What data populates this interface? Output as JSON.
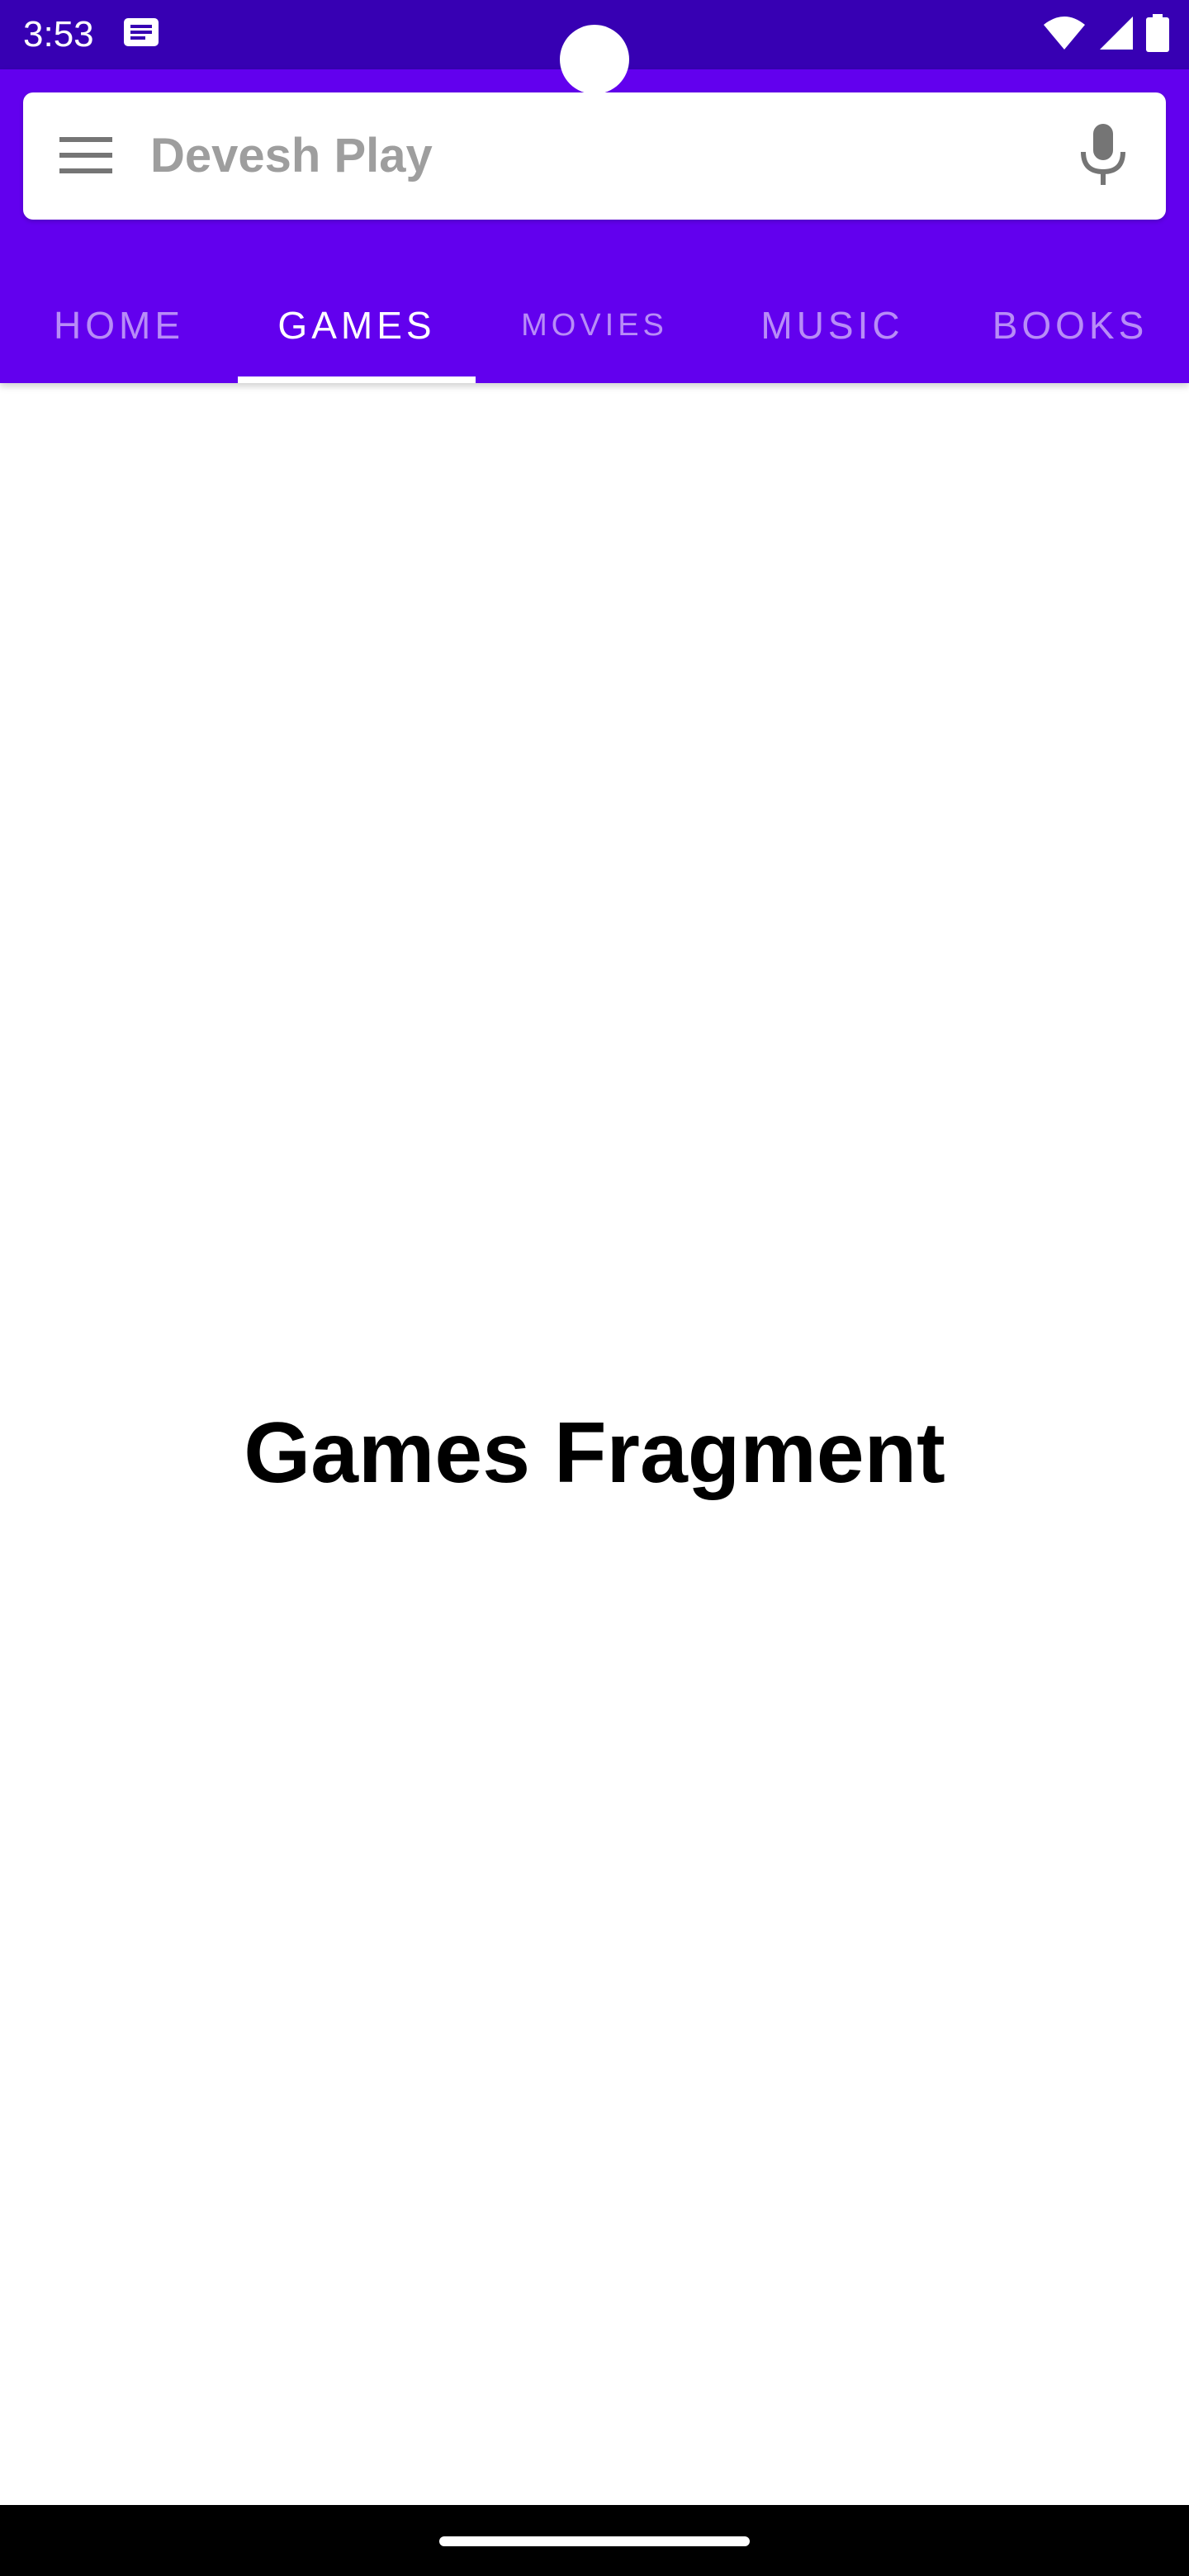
{
  "status_bar": {
    "time": "3:53",
    "notification_icon": "message-icon",
    "wifi_icon": "wifi-icon",
    "signal_icon": "signal-icon",
    "battery_icon": "battery-icon"
  },
  "search": {
    "menu_icon": "menu-icon",
    "text": "Devesh Play",
    "mic_icon": "mic-icon"
  },
  "tabs": [
    {
      "label": "HOME",
      "active": false
    },
    {
      "label": "GAMES",
      "active": true
    },
    {
      "label": "MOVIES",
      "active": false
    },
    {
      "label": "MUSIC",
      "active": false
    },
    {
      "label": "BOOKS",
      "active": false
    }
  ],
  "content": {
    "title": "Games Fragment"
  },
  "colors": {
    "status_bar": "#3700B3",
    "app_bar": "#6200EE",
    "search_text": "#9e9e9e",
    "tab_active": "#ffffff",
    "tab_inactive": "rgba(255,255,255,0.55)"
  }
}
